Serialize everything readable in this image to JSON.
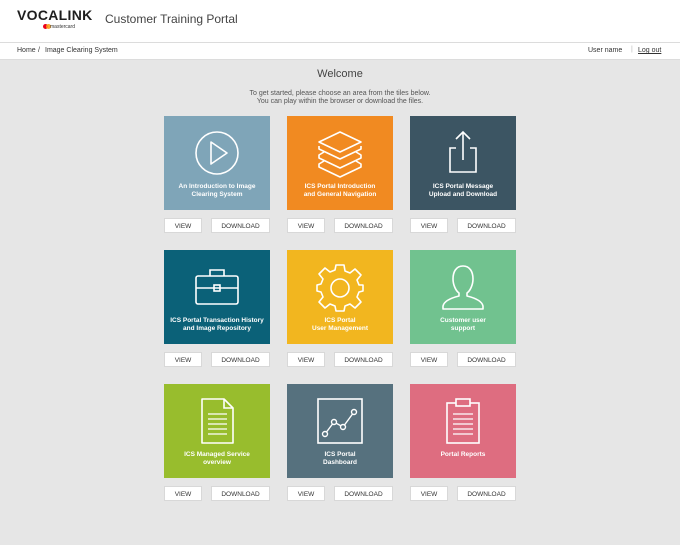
{
  "header": {
    "logo_text": "VOCALINK",
    "logo_sub": "mastercard",
    "portal_title": "Customer Training Portal"
  },
  "breadcrumb": {
    "home": "Home",
    "separator": "/",
    "current": "Image Clearing System"
  },
  "user": {
    "name": "User name",
    "separator": "|",
    "logout": "Log out"
  },
  "main": {
    "welcome": "Welcome",
    "intro_line1": "To get started, please choose an area from the tiles below.",
    "intro_line2": "You can play within the browser or download the files."
  },
  "buttons": {
    "view": "VIEW",
    "download": "DOWNLOAD"
  },
  "tiles": [
    {
      "line1": "An Introduction to Image",
      "line2": "Clearing System",
      "icon": "play-icon",
      "color": "#7fa5b8"
    },
    {
      "line1": "ICS Portal Introduction",
      "line2": "and General Navigation",
      "icon": "layers-icon",
      "color": "#f18a21"
    },
    {
      "line1": "ICS Portal Message",
      "line2": "Upload and Download",
      "icon": "upload-icon",
      "color": "#3c5563"
    },
    {
      "line1": "ICS Portal Transaction History",
      "line2": "and Image Repository",
      "icon": "briefcase-icon",
      "color": "#0b6178"
    },
    {
      "line1": "ICS Portal",
      "line2": "User Management",
      "icon": "gear-icon",
      "color": "#f2b61f"
    },
    {
      "line1": "Customer user",
      "line2": "support",
      "icon": "user-icon",
      "color": "#71c28f"
    },
    {
      "line1": "ICS Managed Service",
      "line2": "overview",
      "icon": "document-icon",
      "color": "#98bd2d"
    },
    {
      "line1": "ICS Portal",
      "line2": "Dashboard",
      "icon": "chart-icon",
      "color": "#56717e"
    },
    {
      "line1": "",
      "line2": "Portal Reports",
      "icon": "clipboard-icon",
      "color": "#de6d80"
    }
  ]
}
